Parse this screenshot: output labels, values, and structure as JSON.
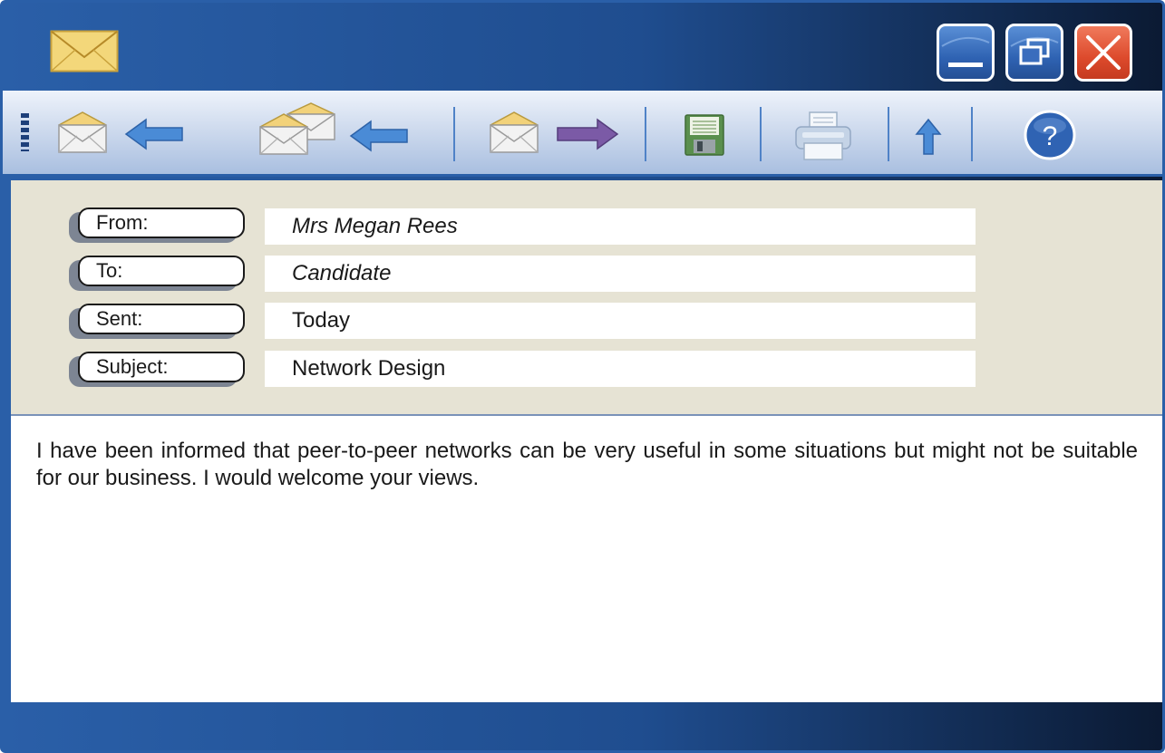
{
  "title_bar": {
    "app_icon": "envelope-icon",
    "buttons": [
      {
        "name": "minimize",
        "icon": "minimize-icon"
      },
      {
        "name": "maximize",
        "icon": "restore-icon"
      },
      {
        "name": "close",
        "icon": "close-icon"
      }
    ]
  },
  "toolbar": {
    "items": [
      {
        "name": "reply",
        "icon": "reply-icon"
      },
      {
        "name": "reply-all",
        "icon": "reply-all-icon"
      },
      {
        "name": "forward",
        "icon": "forward-icon"
      },
      {
        "name": "save",
        "icon": "floppy-disk-icon"
      },
      {
        "name": "print",
        "icon": "printer-icon"
      },
      {
        "name": "upload",
        "icon": "up-arrow-icon"
      },
      {
        "name": "help",
        "icon": "help-icon",
        "label": "?"
      }
    ]
  },
  "message": {
    "fields": [
      {
        "label": "From:",
        "value": "Mrs Megan Rees"
      },
      {
        "label": "To:",
        "value": "Candidate"
      },
      {
        "label": "Sent:",
        "value": "Today"
      },
      {
        "label": "Subject:",
        "value": "Network Design"
      }
    ],
    "body": "I have been informed that peer-to-peer networks can be very useful in some situations but might not be suitable for our business. I would welcome your views."
  },
  "colors": {
    "frame_blue": "#2a5fa8",
    "frame_dark": "#0b1a33",
    "header_panel": "#e6e3d4",
    "close_red": "#dd4a2c",
    "envelope_yellow": "#f3d77a",
    "arrow_blue": "#4a8bd6",
    "arrow_purple": "#7b5aa6"
  }
}
